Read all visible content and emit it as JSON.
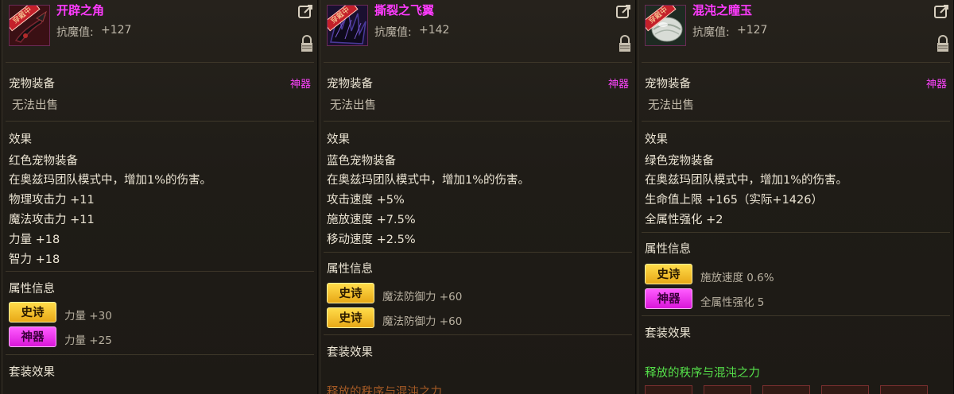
{
  "colors": {
    "item_name": "#ff3bff",
    "rarity": "#ff44ff",
    "epic_badge": "#f2c12e",
    "myth_badge": "#e62ee6",
    "set_name": "#55e04a"
  },
  "panels": [
    {
      "name": "开辟之角",
      "equipped_tag": "穿戴中",
      "resist_label": "抗魔值:",
      "resist_value": "+127",
      "category": "宠物装备",
      "rarity": "神器",
      "sell_status": "无法出售",
      "effect_title": "效果",
      "effects": [
        "红色宠物装备",
        "在奥兹玛团队模式中，增加1%的伤害。",
        "物理攻击力 +11",
        "魔法攻击力 +11",
        "力量 +18",
        "智力 +18"
      ],
      "attr_title": "属性信息",
      "attrs": [
        {
          "badge": "史诗",
          "text": "力量 +30"
        },
        {
          "badge": "神器",
          "text": "力量 +25"
        }
      ],
      "set_title": "套装效果"
    },
    {
      "name": "撕裂之飞翼",
      "equipped_tag": "穿戴中",
      "resist_label": "抗魔值:",
      "resist_value": "+142",
      "category": "宠物装备",
      "rarity": "神器",
      "sell_status": "无法出售",
      "effect_title": "效果",
      "effects": [
        "蓝色宠物装备",
        "在奥兹玛团队模式中，增加1%的伤害。",
        "攻击速度 +5%",
        "施放速度 +7.5%",
        "移动速度 +2.5%"
      ],
      "attr_title": "属性信息",
      "attrs": [
        {
          "badge": "史诗",
          "text": "魔法防御力 +60"
        },
        {
          "badge": "史诗",
          "text": "魔法防御力 +60"
        }
      ],
      "set_title": "套装效果",
      "set_name": "释放的秩序与混沌之力"
    },
    {
      "name": "混沌之瞳玉",
      "equipped_tag": "穿戴中",
      "resist_label": "抗魔值:",
      "resist_value": "+127",
      "category": "宠物装备",
      "rarity": "神器",
      "sell_status": "无法出售",
      "effect_title": "效果",
      "effects": [
        "绿色宠物装备",
        "在奥兹玛团队模式中，增加1%的伤害。",
        "生命值上限 +165（实际+1426）",
        "全属性强化 +2"
      ],
      "attr_title": "属性信息",
      "attrs": [
        {
          "badge": "史诗",
          "text": "施放速度 0.6%"
        },
        {
          "badge": "神器",
          "text": "全属性强化 5"
        }
      ],
      "set_title": "套装效果",
      "set_name": "释放的秩序与混沌之力"
    }
  ]
}
